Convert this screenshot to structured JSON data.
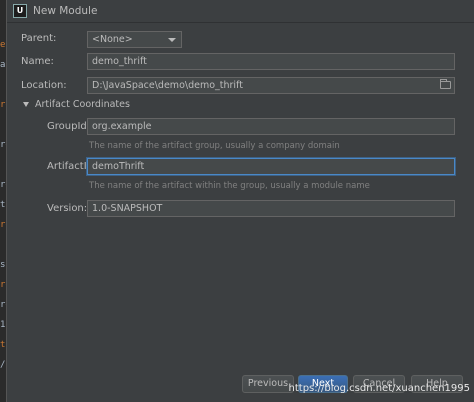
{
  "window": {
    "title": "New Module",
    "app_icon": "U"
  },
  "form": {
    "parent": {
      "label": "Parent:",
      "value": "<None>"
    },
    "name": {
      "label": "Name:",
      "value": "demo_thrift"
    },
    "location": {
      "label": "Location:",
      "value": "D:\\JavaSpace\\demo\\demo_thrift"
    }
  },
  "artifact": {
    "section_title": "Artifact Coordinates",
    "group_id": {
      "label": "GroupId:",
      "value": "org.example",
      "hint": "The name of the artifact group, usually a company domain"
    },
    "artifact_id": {
      "label": "ArtifactId:",
      "value": "demoThrift",
      "hint": "The name of the artifact within the group, usually a module name"
    },
    "version": {
      "label": "Version:",
      "value": "1.0-SNAPSHOT"
    }
  },
  "buttons": {
    "previous": "Previous",
    "next": "Next",
    "cancel": "Cancel",
    "help": "Help"
  },
  "watermark": "https://blog.csdn.net/xuanchen1995",
  "background_editor_lines": [
    "",
    "es",
    "ar",
    "",
    "rg",
    "",
    "rg",
    "",
    "rg",
    "ts/",
    "rg",
    "",
    "s",
    "rg",
    "rg",
    "1",
    "ts/",
    "/"
  ],
  "colors": {
    "dialog_bg": "#3c3f41",
    "field_bg": "#45494a",
    "focus": "#4a88c7",
    "primary": "#365880"
  }
}
